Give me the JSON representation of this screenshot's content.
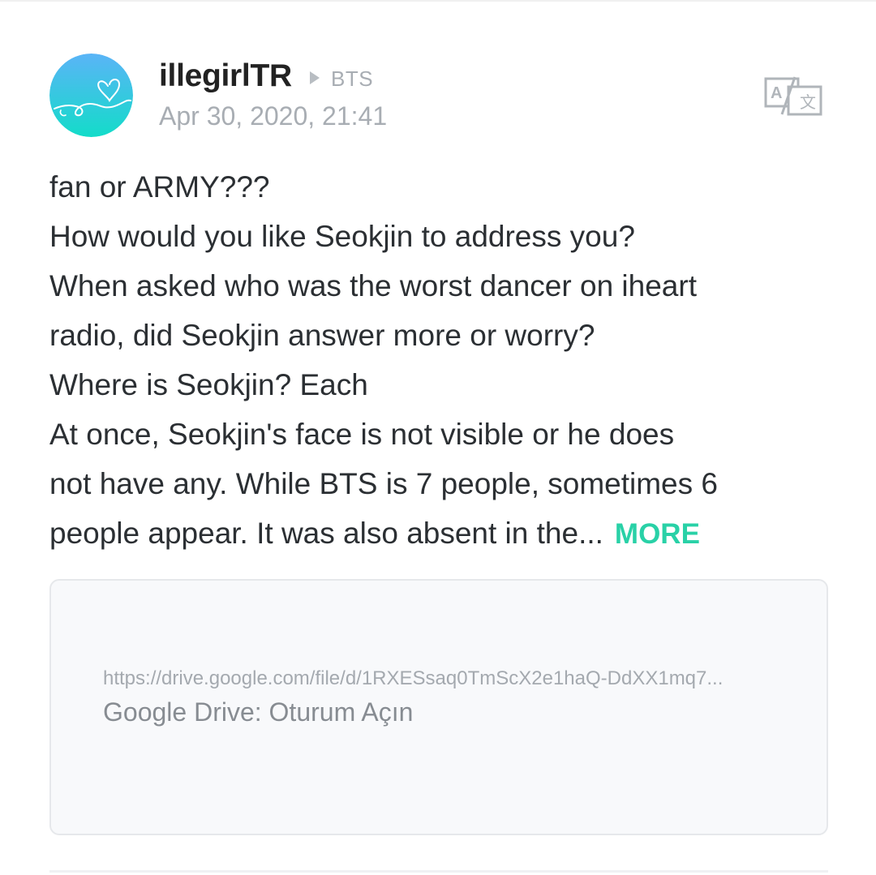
{
  "post": {
    "author": "illegirlTR",
    "community": "BTS",
    "timestamp": "Apr 30, 2020, 21:41",
    "avatar_icon": "heart-doodle-icon",
    "translate_icon": "translate-icon",
    "body_lines": [
      "fan or ARMY???",
      "How would you like Seokjin to address you?",
      "When asked who was the worst dancer on iheart",
      "radio, did Seokjin answer more or worry?",
      "Where is Seokjin? Each",
      "At once, Seokjin's face is not visible or he does",
      "not have any. While BTS is 7 people, sometimes 6",
      "people appear. It was also absent in the..."
    ],
    "more_label": "MORE"
  },
  "link_preview": {
    "url": "https://drive.google.com/file/d/1RXESsaq0TmScX2e1haQ-DdXX1mq7...",
    "title": "Google Drive: Oturum Açın"
  },
  "colors": {
    "accent": "#29d1a7",
    "avatar_gradient_top": "#5ab4f7",
    "avatar_gradient_bottom": "#13dcc9",
    "meta_text": "#a8adb3",
    "body_text": "#2b2f33"
  }
}
